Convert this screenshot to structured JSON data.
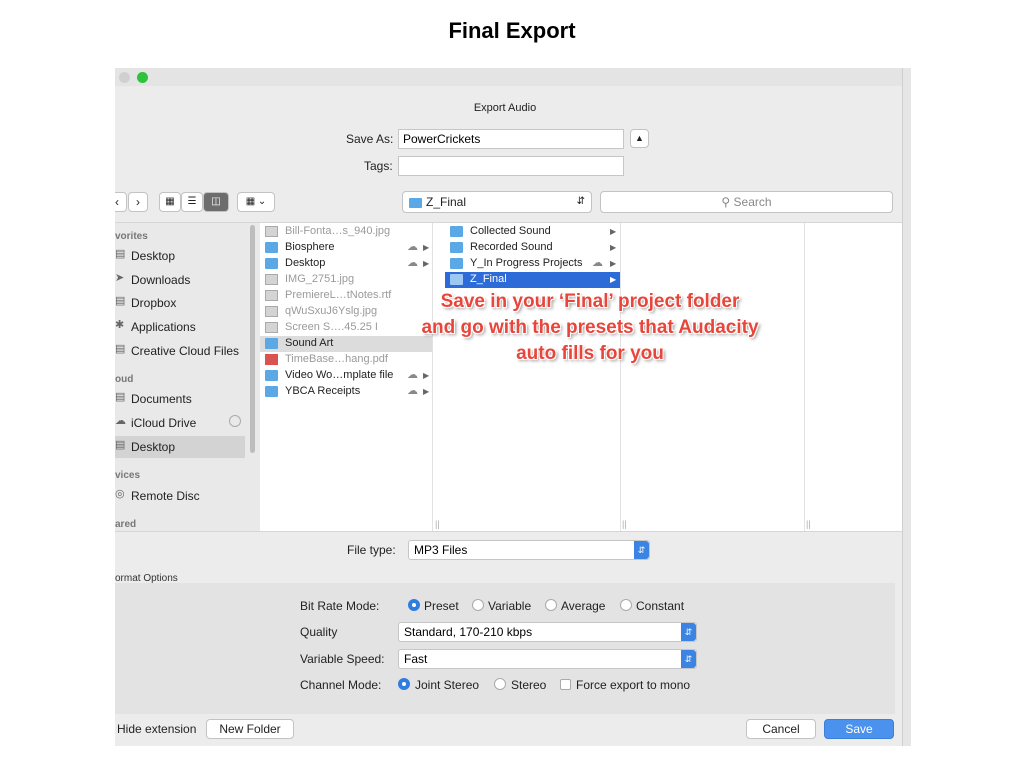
{
  "slide_title": "Final Export",
  "dialog": {
    "title": "Export Audio",
    "save_as_label": "Save As:",
    "save_as_value": "PowerCrickets",
    "tags_label": "Tags:",
    "tags_value": "",
    "location": "Z_Final",
    "search_placeholder": "Search"
  },
  "sidebar": {
    "favorites_header": "vorites",
    "favorites": [
      "Desktop",
      "Downloads",
      "Dropbox",
      "Applications",
      "Creative Cloud Files"
    ],
    "cloud_header": "oud",
    "cloud": [
      "Documents",
      "iCloud Drive",
      "Desktop"
    ],
    "devices_header": "vices",
    "devices": [
      "Remote Disc"
    ],
    "shared_header": "ared"
  },
  "column1": [
    {
      "name": "Bill-Fonta…s_940.jpg",
      "kind": "file"
    },
    {
      "name": "Biosphere",
      "kind": "folder"
    },
    {
      "name": "Desktop",
      "kind": "folder"
    },
    {
      "name": "IMG_2751.jpg",
      "kind": "file"
    },
    {
      "name": "PremiereL…tNotes.rtf",
      "kind": "file"
    },
    {
      "name": "qWuSxuJ6Yslg.jpg",
      "kind": "file"
    },
    {
      "name": "Screen S….45.25 I",
      "kind": "file"
    },
    {
      "name": "Sound Art",
      "kind": "folder"
    },
    {
      "name": "TimeBase…hang.pdf",
      "kind": "file"
    },
    {
      "name": "Video Wo…mplate file",
      "kind": "folder"
    },
    {
      "name": "YBCA Receipts",
      "kind": "folder"
    }
  ],
  "column2": [
    {
      "name": "Collected Sound"
    },
    {
      "name": "Recorded Sound"
    },
    {
      "name": "Y_In Progress Projects"
    },
    {
      "name": "Z_Final"
    }
  ],
  "annotation": {
    "line1": "Save in your ‘Final’ project folder",
    "line2": "and go with the presets that Audacity",
    "line3": "auto fills for you"
  },
  "file_type": {
    "label": "File type:",
    "value": "MP3 Files"
  },
  "format_options": {
    "header": "ormat Options",
    "bit_rate_mode_label": "Bit Rate Mode:",
    "bit_rate_modes": [
      "Preset",
      "Variable",
      "Average",
      "Constant"
    ],
    "bit_rate_mode_selected": "Preset",
    "quality_label": "Quality",
    "quality_value": "Standard, 170-210 kbps",
    "variable_speed_label": "Variable Speed:",
    "variable_speed_value": "Fast",
    "channel_mode_label": "Channel Mode:",
    "channel_modes": [
      "Joint Stereo",
      "Stereo"
    ],
    "channel_mode_selected": "Joint Stereo",
    "force_mono_label": "Force export to mono"
  },
  "buttons": {
    "hide_extension": "Hide extension",
    "new_folder": "New Folder",
    "cancel": "Cancel",
    "save": "Save"
  },
  "colors": {
    "accent": "#2f7de1",
    "annotation": "#e8463b",
    "selection": "#2d6bd8"
  }
}
